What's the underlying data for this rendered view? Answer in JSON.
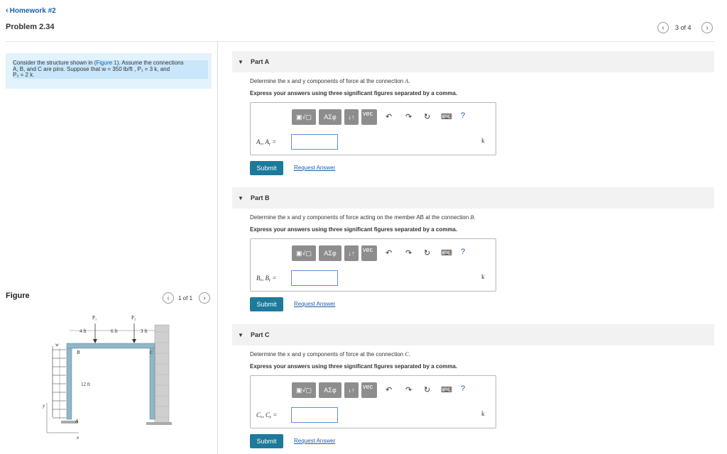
{
  "header": {
    "back_link": "Homework #2",
    "problem_title": "Problem 2.34",
    "pager_text": "3 of 4"
  },
  "prompt": {
    "line1_pre": "Consider the structure shown in (",
    "figure_link": "Figure 1",
    "line1_post": "). Assume the connections",
    "line2": "A, B, and C are pins. Suppose that w = 350 lb/ft , P₁ = 3 k, and",
    "line3": "P₂ = 2 k."
  },
  "figure": {
    "label": "Figure",
    "pager_text": "1 of 1",
    "labels": {
      "p1": "P₁",
      "p2": "P₂",
      "dim1": "4 ft",
      "dim2": "6 ft",
      "dim3": "3 ft",
      "w": "w",
      "b": "B",
      "c": "C",
      "a": "A",
      "height": "12 ft",
      "y": "y",
      "x": "x"
    }
  },
  "toolbar": {
    "templates": "▣√▢",
    "greek": "ΑΣφ",
    "arrows": "↓↑",
    "vec": "vec",
    "undo_icon": "↶",
    "redo_icon": "↷",
    "reset_icon": "↻",
    "keyboard_icon": "⌨",
    "help": "?"
  },
  "parts": [
    {
      "title": "Part A",
      "question_pre": "Determine the x and y components of force at the connection ",
      "question_var": "A",
      "question_post": ".",
      "instruction": "Express your answers using three significant figures separated by a comma.",
      "answer_label": "Aₓ, Aᵧ =",
      "input_value": "",
      "unit": "k",
      "submit": "Submit",
      "request": "Request Answer"
    },
    {
      "title": "Part B",
      "question_pre": "Determine the x and y components of force acting on the member AB at the connection ",
      "question_var": "B",
      "question_post": ".",
      "instruction": "Express your answers using three significant figures separated by a comma.",
      "answer_label": "Bₓ, Bᵧ =",
      "input_value": "",
      "unit": "k",
      "submit": "Submit",
      "request": "Request Answer"
    },
    {
      "title": "Part C",
      "question_pre": "Determine the x and y components of force at the connection ",
      "question_var": "C",
      "question_post": ".",
      "instruction": "Express your answers using three significant figures separated by a comma.",
      "answer_label": "Cₓ, Cᵧ =",
      "input_value": "",
      "unit": "k",
      "submit": "Submit",
      "request": "Request Answer"
    }
  ]
}
